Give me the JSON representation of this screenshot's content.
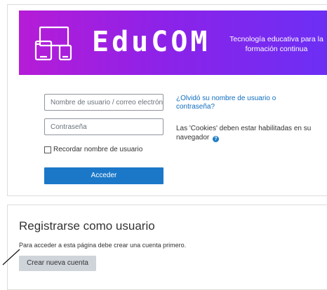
{
  "banner": {
    "brand_name": "EduCOM",
    "tagline": "Tecnología educativa  para la formación continua",
    "icon": "devices-icon",
    "gradient_colors": [
      "#b61cd6",
      "#6b2ff5"
    ]
  },
  "login": {
    "username_placeholder": "Nombre de usuario / correo electrónico",
    "password_placeholder": "Contraseña",
    "remember_label": "Recordar nombre de usuario",
    "submit_label": "Acceder",
    "forgot_link": "¿Olvidó su nombre de usuario o contraseña?",
    "cookies_notice": "Las 'Cookies' deben estar habilitadas en su navegador",
    "help_icon": "question-circle-icon",
    "accent_color": "#1b78c9"
  },
  "register": {
    "title": "Registrarse como usuario",
    "note": "Para acceder a esta página debe crear una cuenta primero.",
    "create_account_label": "Crear nueva cuenta"
  }
}
